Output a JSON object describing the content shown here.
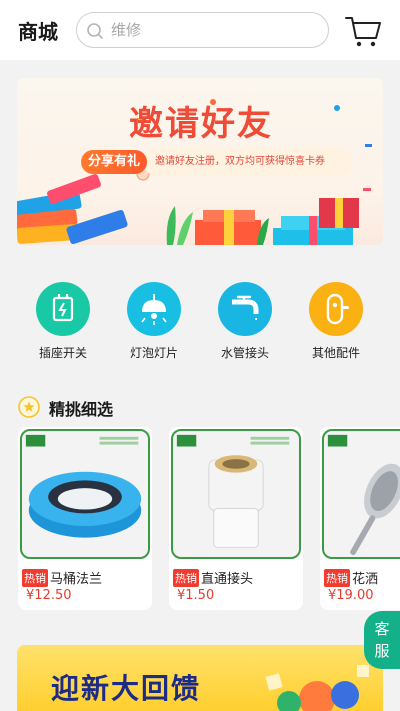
{
  "header": {
    "title": "商城",
    "search_placeholder": "维修",
    "cart_icon": "cart-icon"
  },
  "banner": {
    "title": "邀请好友",
    "share_label": "分享有礼",
    "invite_text": "邀请好友注册，双方均可获得惊喜卡券"
  },
  "categories": [
    {
      "label": "插座开关",
      "icon": "socket-icon",
      "color": "#19c9a6"
    },
    {
      "label": "灯泡灯片",
      "icon": "lamp-icon",
      "color": "#18bfe3"
    },
    {
      "label": "水管接头",
      "icon": "faucet-icon",
      "color": "#1ab6e3"
    },
    {
      "label": "其他配件",
      "icon": "lock-icon",
      "color": "#fbb112"
    }
  ],
  "featured": {
    "title": "精挑细选",
    "products": [
      {
        "tag": "热销",
        "name": "马桶法兰",
        "price": "¥12.50"
      },
      {
        "tag": "热销",
        "name": "直通接头",
        "price": "¥1.50"
      },
      {
        "tag": "热销",
        "name": "花洒",
        "price": "¥19.00"
      }
    ]
  },
  "promo": {
    "title": "迎新大回馈"
  },
  "service": {
    "label_line1": "客",
    "label_line2": "服"
  },
  "colors": {
    "accent_green": "#14b08a",
    "hot_red": "#f23b2f",
    "price_red": "#e53b2f",
    "banner_red": "#ef4b36",
    "promo_yellow": "#ffcf2f"
  }
}
